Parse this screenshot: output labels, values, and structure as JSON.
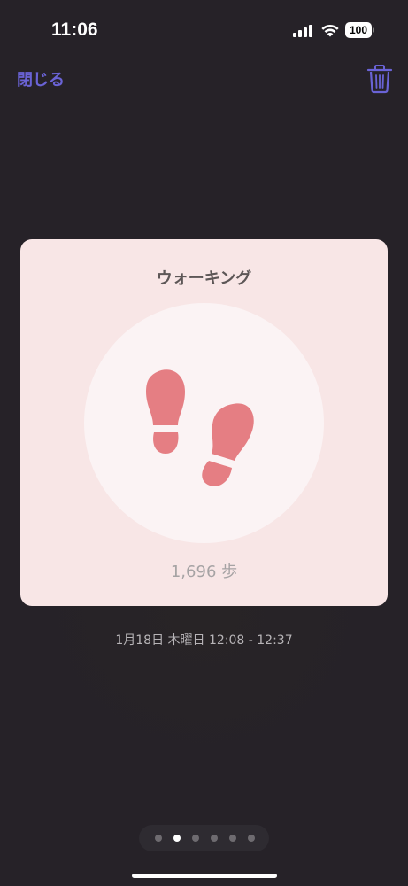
{
  "status_bar": {
    "time": "11:06",
    "battery": "100"
  },
  "nav": {
    "close_label": "閉じる",
    "trash_icon": "trash-icon"
  },
  "card": {
    "title": "ウォーキング",
    "icon": "footprints-icon",
    "steps": "1,696 歩"
  },
  "date_range": "1月18日 木曜日 12:08 - 12:37",
  "pagination": {
    "total": 6,
    "current": 2
  },
  "colors": {
    "accent": "#6a63d6",
    "card_bg": "#f8e6e6",
    "footprint": "#e57e83",
    "background": "#262228"
  }
}
